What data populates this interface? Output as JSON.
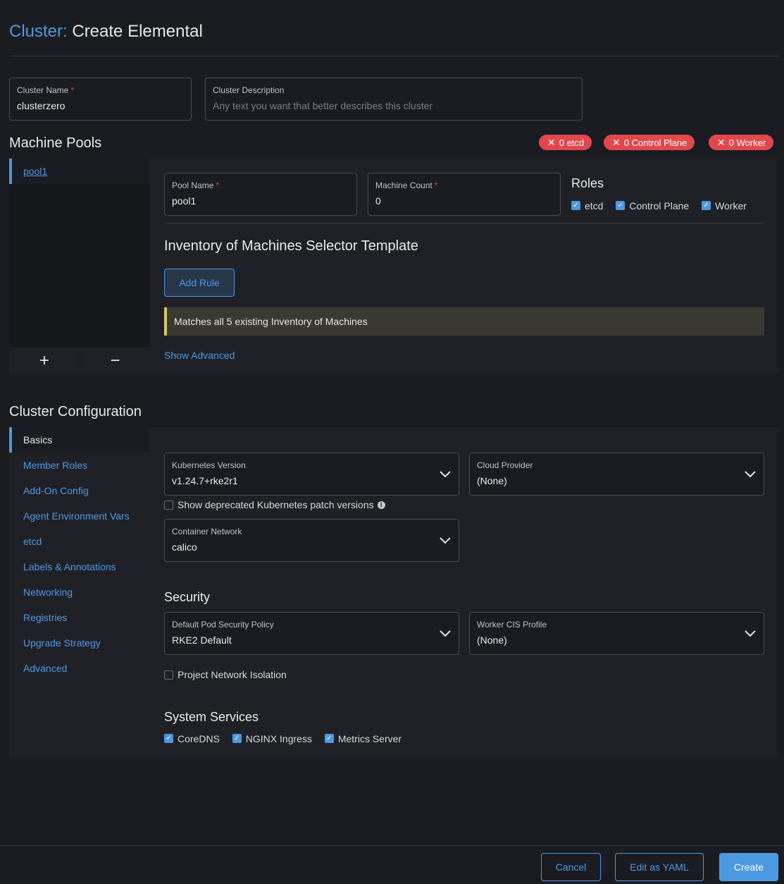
{
  "header": {
    "title_prefix": "Cluster:",
    "title_rest": "Create Elemental"
  },
  "cluster_name": {
    "label": "Cluster Name",
    "required": "*",
    "value": "clusterzero"
  },
  "cluster_description": {
    "label": "Cluster Description",
    "placeholder": "Any text you want that better describes this cluster"
  },
  "machine_pools": {
    "title": "Machine Pools",
    "badges": [
      {
        "icon": "close-icon",
        "text": "0 etcd"
      },
      {
        "icon": "close-icon",
        "text": "0 Control Plane"
      },
      {
        "icon": "close-icon",
        "text": "0 Worker"
      }
    ],
    "pools": [
      "pool1"
    ],
    "add_symbol": "+",
    "remove_symbol": "−",
    "pool_name": {
      "label": "Pool Name",
      "required": "*",
      "value": "pool1"
    },
    "machine_count": {
      "label": "Machine Count",
      "required": "*",
      "value": "0"
    },
    "roles": {
      "title": "Roles",
      "items": [
        {
          "label": "etcd",
          "checked": true
        },
        {
          "label": "Control Plane",
          "checked": true
        },
        {
          "label": "Worker",
          "checked": true
        }
      ]
    },
    "inventory_title": "Inventory of Machines Selector Template",
    "add_rule": "Add Rule",
    "alert": "Matches all 5 existing Inventory of Machines",
    "show_advanced": "Show Advanced"
  },
  "cluster_config": {
    "title": "Cluster Configuration",
    "tabs": [
      "Basics",
      "Member Roles",
      "Add-On Config",
      "Agent Environment Vars",
      "etcd",
      "Labels & Annotations",
      "Networking",
      "Registries",
      "Upgrade Strategy",
      "Advanced"
    ],
    "kubernetes_version": {
      "label": "Kubernetes Version",
      "value": "v1.24.7+rke2r1"
    },
    "cloud_provider": {
      "label": "Cloud Provider",
      "value": "(None)"
    },
    "show_deprecated": {
      "label": "Show deprecated Kubernetes patch versions",
      "checked": false
    },
    "container_network": {
      "label": "Container Network",
      "value": "calico"
    },
    "security": {
      "title": "Security",
      "psp": {
        "label": "Default Pod Security Policy",
        "value": "RKE2 Default"
      },
      "cis": {
        "label": "Worker CIS Profile",
        "value": "(None)"
      },
      "network_isolation": {
        "label": "Project Network Isolation",
        "checked": false
      }
    },
    "system_services": {
      "title": "System Services",
      "items": [
        {
          "label": "CoreDNS",
          "checked": true
        },
        {
          "label": "NGINX Ingress",
          "checked": true
        },
        {
          "label": "Metrics Server",
          "checked": true
        }
      ]
    }
  },
  "footer": {
    "cancel": "Cancel",
    "edit_yaml": "Edit as YAML",
    "create": "Create"
  },
  "colors": {
    "accent": "#4c9ae2",
    "danger": "#e0484e",
    "warning": "#d8c86a",
    "background": "#1b1c21",
    "panel": "#202127"
  }
}
